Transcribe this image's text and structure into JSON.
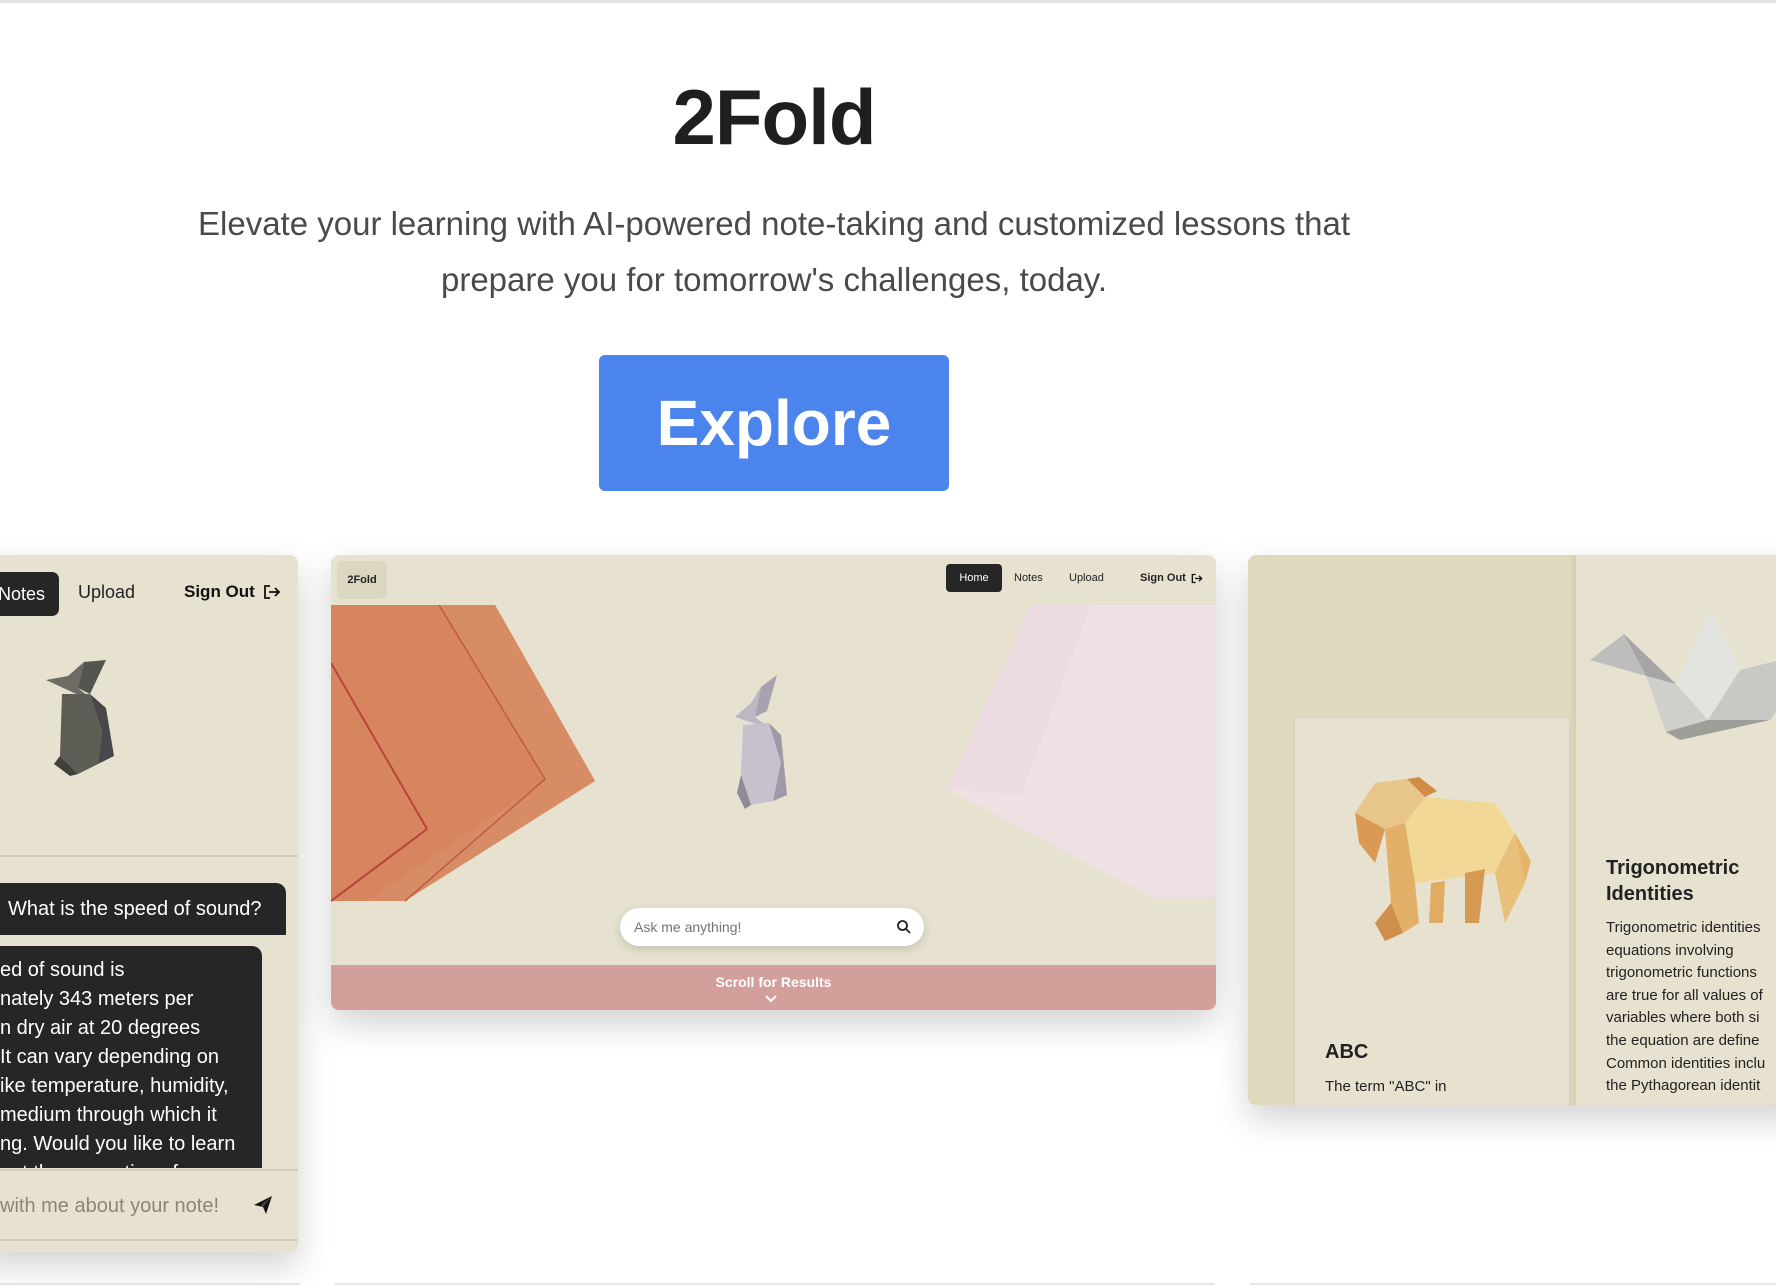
{
  "hero": {
    "title": "2Fold",
    "subtitle_line1": "Elevate your learning with AI-powered note-taking and customized lessons that",
    "subtitle_line2": "prepare you for tomorrow's challenges, today.",
    "cta_label": "Explore"
  },
  "colors": {
    "accent": "#4a84ec",
    "card_bg": "#e6e2cf",
    "dark": "#262626",
    "scroll_bar": "#d39f9b"
  },
  "left_card": {
    "nav": {
      "notes": "Notes",
      "upload": "Upload",
      "sign_out": "Sign Out",
      "sign_out_icon": "sign-out-icon"
    },
    "chat_question": "What is the speed of sound?",
    "chat_answer": "ed of sound is\nnately 343 meters per\nn dry air at 20 degrees\nIt can vary depending on\nike temperature, humidity,\nmedium through which it\nng. Would you like to learn\nout the properties of",
    "chat_input_placeholder": "with me about your note!",
    "send_icon": "paper-plane-icon"
  },
  "mid_card": {
    "brand": "2Fold",
    "nav": {
      "home": "Home",
      "notes": "Notes",
      "upload": "Upload",
      "sign_out": "Sign Out"
    },
    "search_placeholder": "Ask me anything!",
    "search_icon": "search-icon",
    "scroll_label": "Scroll for Results",
    "scroll_icon": "chevron-down-icon"
  },
  "right_card": {
    "abc_title": "ABC",
    "abc_text": "The term \"ABC\" in",
    "trig_title": "Trigonometric Identities",
    "trig_text": "Trigonometric identities\nequations involving\ntrigonometric functions\nare true for all values of\nvariables where both si\nthe equation are define\nCommon identities inclu\nthe Pythagorean identit"
  }
}
